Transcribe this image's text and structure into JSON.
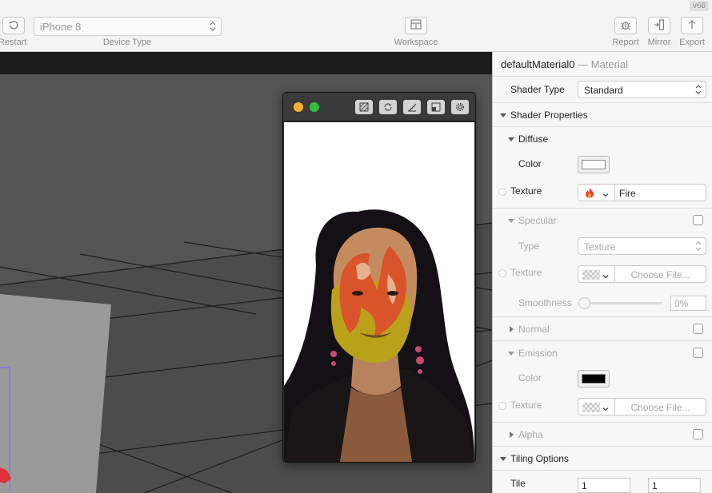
{
  "toolbar": {
    "restart_label": "Restart",
    "device_type_value": "iPhone 8",
    "device_type_label": "Device Type",
    "workspace_label": "Workspace",
    "report_label": "Report",
    "mirror_label": "Mirror",
    "export_label": "Export",
    "version": "v66"
  },
  "simulator": {
    "traffic_lights": [
      "#f5b02f",
      "#31c13f"
    ],
    "tools": [
      "filter-icon",
      "refresh-icon",
      "ruler-icon",
      "window-icon",
      "gear-icon"
    ]
  },
  "inspector": {
    "title": "defaultMaterial0",
    "title_separator": "—",
    "subtitle": "Material",
    "shader_type_label": "Shader Type",
    "shader_type_value": "Standard",
    "shader_properties_label": "Shader Properties",
    "diffuse": {
      "label": "Diffuse",
      "color_label": "Color",
      "color": "#ffffff",
      "texture_label": "Texture",
      "texture_value": "Fire"
    },
    "specular": {
      "label": "Specular",
      "type_label": "Type",
      "type_value": "Texture",
      "texture_label": "Texture",
      "texture_value": "Choose File...",
      "smoothness_label": "Smoothness",
      "smoothness_value": "0%"
    },
    "normal_label": "Normal",
    "emission": {
      "label": "Emission",
      "color_label": "Color",
      "color": "#000000",
      "texture_label": "Texture",
      "texture_value": "Choose File..."
    },
    "alpha_label": "Alpha",
    "tiling_options_label": "Tiling Options",
    "tile_label": "Tile",
    "tile_x": "1",
    "tile_y": "1"
  }
}
